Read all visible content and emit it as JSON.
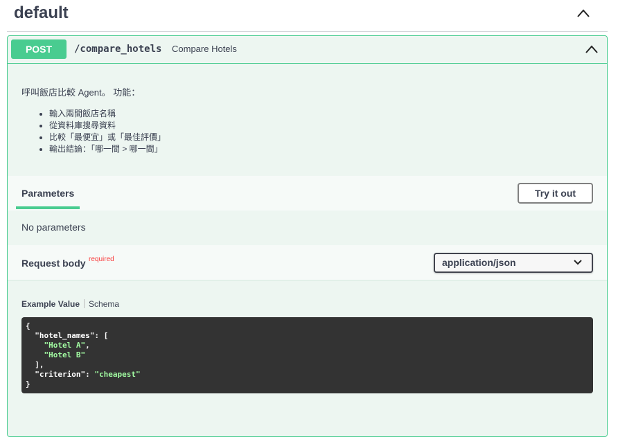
{
  "tag": {
    "title": "default"
  },
  "operation": {
    "method": "POST",
    "path": "/compare_hotels",
    "summary": "Compare Hotels",
    "description": "呼叫飯店比較 Agent。 功能：",
    "bullets": [
      "輸入兩間飯店名稱",
      "從資料庫搜尋資料",
      "比較「最便宜」或「最佳評價」",
      "輸出結論：「哪一間 > 哪一間」"
    ]
  },
  "parameters": {
    "tab_label": "Parameters",
    "try_button": "Try it out",
    "empty_text": "No parameters"
  },
  "request_body": {
    "title": "Request body",
    "required_label": "required",
    "content_type": "application/json",
    "example_tab": "Example Value",
    "schema_tab": "Schema",
    "example": {
      "open": "{",
      "key1": "\"hotel_names\"",
      "after_key1": ": [",
      "item1": "\"Hotel A\"",
      "comma1": ",",
      "item2": "\"Hotel B\"",
      "close_array": "],",
      "key2": "\"criterion\"",
      "colon2": ": ",
      "val2": "\"cheapest\"",
      "close": "}"
    }
  },
  "colors": {
    "post_green": "#49cc90",
    "block_bg": "#edf6f1",
    "code_bg": "#333333",
    "string_green": "#a2fca2",
    "required_red": "#f93e3e"
  }
}
